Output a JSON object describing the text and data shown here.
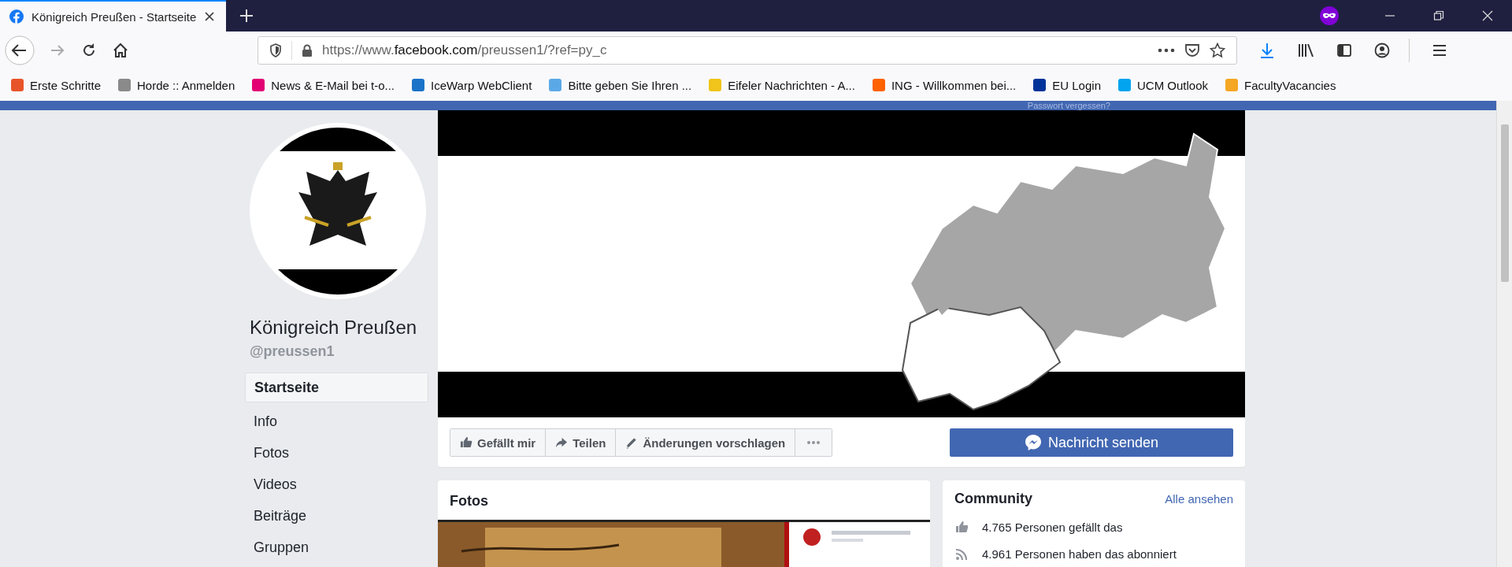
{
  "browser": {
    "tabs": [
      {
        "title": "Königreich Preußen - Startseite",
        "selected": true
      }
    ],
    "url": {
      "prefix": "https://www.",
      "domain": "facebook.com",
      "path": "/preussen1/?ref=py_c"
    },
    "bookmarks": [
      {
        "label": "Erste Schritte",
        "color": "#e8542a"
      },
      {
        "label": "Horde :: Anmelden",
        "color": "#8a8a8a"
      },
      {
        "label": "News & E-Mail bei t-o...",
        "color": "#e20074"
      },
      {
        "label": "IceWarp WebClient",
        "color": "#1a73c8"
      },
      {
        "label": "Bitte geben Sie Ihren ...",
        "color": "#5aa9e6"
      },
      {
        "label": "Eifeler Nachrichten - A...",
        "color": "#f0c419"
      },
      {
        "label": "ING - Willkommen bei...",
        "color": "#ff6200"
      },
      {
        "label": "EU Login",
        "color": "#003399"
      },
      {
        "label": "UCM Outlook",
        "color": "#00a4ef"
      },
      {
        "label": "FacultyVacancies",
        "color": "#f5a623"
      }
    ]
  },
  "page": {
    "top_bar_link": "Passwort vergessen?",
    "profile": {
      "name": "Königreich Preußen",
      "handle": "@preussen1"
    },
    "nav": [
      {
        "label": "Startseite",
        "selected": true
      },
      {
        "label": "Info",
        "selected": false
      },
      {
        "label": "Fotos",
        "selected": false
      },
      {
        "label": "Videos",
        "selected": false
      },
      {
        "label": "Beiträge",
        "selected": false
      },
      {
        "label": "Gruppen",
        "selected": false
      }
    ],
    "actions": [
      {
        "label": "Gefällt mir"
      },
      {
        "label": "Teilen"
      },
      {
        "label": "Änderungen vorschlagen"
      }
    ],
    "message_button": "Nachricht senden",
    "photos": {
      "title": "Fotos"
    },
    "community": {
      "title": "Community",
      "link": "Alle ansehen",
      "stats": [
        "4.765 Personen gefällt das",
        "4.961 Personen haben das abonniert"
      ]
    }
  }
}
